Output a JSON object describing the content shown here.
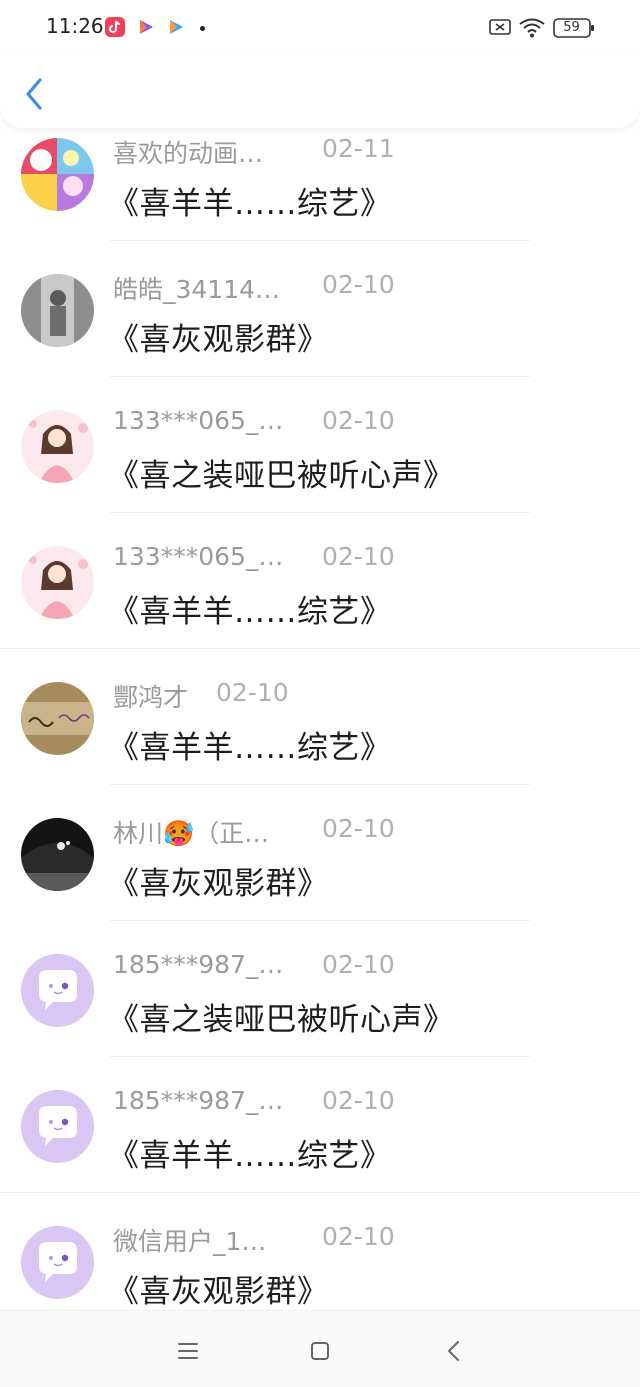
{
  "status_bar": {
    "time": "11:26",
    "battery": "59",
    "app_icons": [
      "douyin-icon",
      "video-play-icon",
      "video-play-icon"
    ]
  },
  "header": {
    "back_icon": "chevron-left-icon",
    "accent": "#3a8ee6"
  },
  "messages": [
    {
      "name": "喜欢的动画…",
      "date": "02-11",
      "title": "《喜羊羊……综艺》",
      "avatar": "cartoon-collage"
    },
    {
      "name": "皓皓_34114…",
      "date": "02-10",
      "title": "《喜灰观影群》",
      "avatar": "gray-photo"
    },
    {
      "name": "133***065_…",
      "date": "02-10",
      "title": "《喜之装哑巴被听心声》",
      "avatar": "anime-girl"
    },
    {
      "name": "133***065_…",
      "date": "02-10",
      "title": "《喜羊羊……综艺》",
      "avatar": "anime-girl"
    },
    {
      "name": "酆鸿才",
      "date": "02-10",
      "title": "《喜羊羊……综艺》",
      "avatar": "handwriting-photo"
    },
    {
      "name": "林川🥵（正…",
      "date": "02-10",
      "title": "《喜灰观影群》",
      "avatar": "dark-photo"
    },
    {
      "name": "185***987_…",
      "date": "02-10",
      "title": "《喜之装哑巴被听心声》",
      "avatar": "default-chat"
    },
    {
      "name": "185***987_…",
      "date": "02-10",
      "title": "《喜羊羊……综艺》",
      "avatar": "default-chat"
    },
    {
      "name": "微信用户_1…",
      "date": "02-10",
      "title": "《喜灰观影群》",
      "avatar": "default-chat"
    }
  ],
  "nav": {
    "menu_icon": "menu-icon",
    "home_icon": "home-square-icon",
    "back_icon": "back-triangle-icon"
  }
}
